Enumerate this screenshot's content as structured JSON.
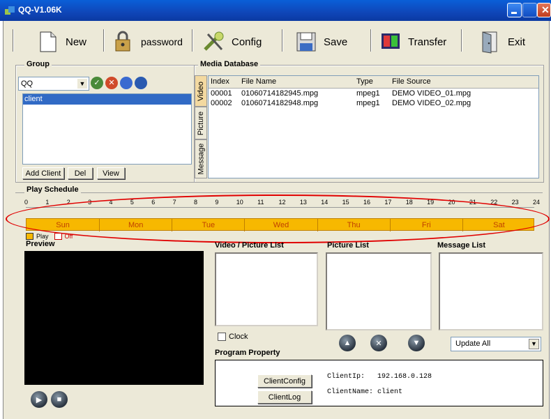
{
  "window": {
    "title": "QQ-V1.06K"
  },
  "toolbar": {
    "new_label": "New",
    "password_label": "password",
    "config_label": "Config",
    "save_label": "Save",
    "transfer_label": "Transfer",
    "exit_label": "Exit"
  },
  "group": {
    "title": "Group",
    "selected": "QQ",
    "clients": [
      "client"
    ],
    "add_client_label": "Add Client",
    "del_label": "Del",
    "view_label": "View"
  },
  "media_db": {
    "title": "Media Database",
    "tabs": [
      "Video",
      "Picture",
      "Message"
    ],
    "columns": [
      "Index",
      "File Name",
      "Type",
      "File Source"
    ],
    "rows": [
      [
        "00001",
        "01060714182945.mpg",
        "mpeg1",
        "DEMO VIDEO_01.mpg"
      ],
      [
        "00002",
        "01060714182948.mpg",
        "mpeg1",
        "DEMO VIDEO_02.mpg"
      ]
    ]
  },
  "schedule": {
    "title": "Play Schedule",
    "hours": [
      "0",
      "1",
      "2",
      "3",
      "4",
      "5",
      "6",
      "7",
      "8",
      "9",
      "10",
      "11",
      "12",
      "13",
      "14",
      "15",
      "16",
      "17",
      "18",
      "19",
      "20",
      "21",
      "22",
      "23",
      "24"
    ],
    "days": [
      "Sun",
      "Mon",
      "Tue",
      "Wed",
      "Thu",
      "Fri",
      "Sat"
    ],
    "legend_play": "Play",
    "legend_off": "Off",
    "highlight_color": "#e00000",
    "play_color": "#f7b800"
  },
  "preview": {
    "title": "Preview"
  },
  "lists": {
    "video_picture": "Video / Picture List",
    "picture": "Picture List",
    "message": "Message List",
    "clock_label": "Clock",
    "update_value": "Update All"
  },
  "program": {
    "title": "Program Property",
    "client_config_label": "ClientConfig",
    "client_log_label": "ClientLog",
    "ip_label": "ClientIp:",
    "ip_value": "192.168.0.128",
    "name_label": "ClientName:",
    "name_value": "client"
  },
  "icons": {
    "new": "document-icon",
    "password": "lock-icon",
    "config": "wrench-icon",
    "save": "floppy-icon",
    "transfer": "transfer-icon",
    "exit": "door-icon"
  }
}
